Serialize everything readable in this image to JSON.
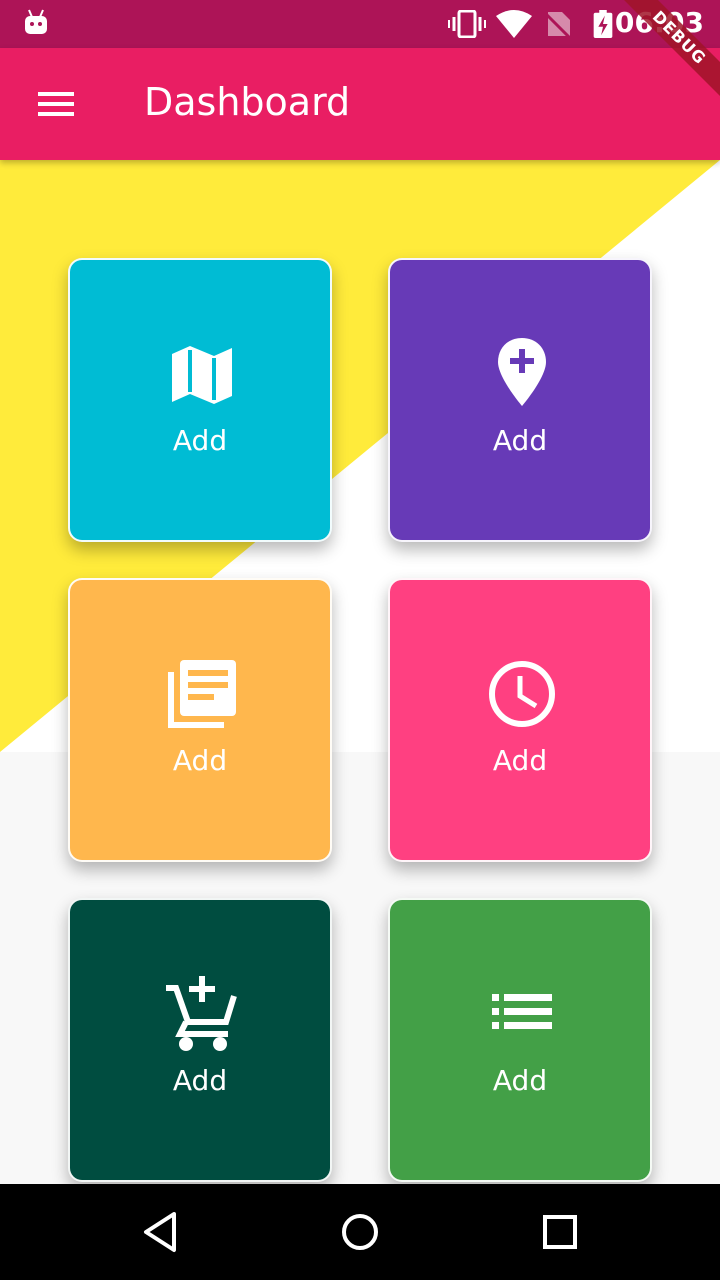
{
  "status_bar": {
    "time": "06:03",
    "icons": [
      "android-debug-icon",
      "vibrate-icon",
      "wifi-icon",
      "no-sim-icon",
      "battery-charging-icon"
    ]
  },
  "debug_banner": {
    "label": "DEBUG"
  },
  "app_bar": {
    "title": "Dashboard",
    "menu_icon": "hamburger-menu-icon"
  },
  "colors": {
    "status_bar": "#ad1457",
    "app_bar": "#e91e63",
    "background_accent": "#ffeb3b",
    "background": "#f8f8f8"
  },
  "tiles": [
    {
      "label": "Add",
      "icon": "map-icon",
      "color": "#00bcd4"
    },
    {
      "label": "Add",
      "icon": "add-location-icon",
      "color": "#673ab7"
    },
    {
      "label": "Add",
      "icon": "library-books-icon",
      "color": "#ffb74d"
    },
    {
      "label": "Add",
      "icon": "clock-icon",
      "color": "#ff4081"
    },
    {
      "label": "Add",
      "icon": "add-shopping-cart-icon",
      "color": "#004d40"
    },
    {
      "label": "Add",
      "icon": "list-icon",
      "color": "#43a047"
    }
  ],
  "nav_bar": {
    "buttons": [
      "back-icon",
      "home-icon",
      "recents-icon"
    ]
  }
}
